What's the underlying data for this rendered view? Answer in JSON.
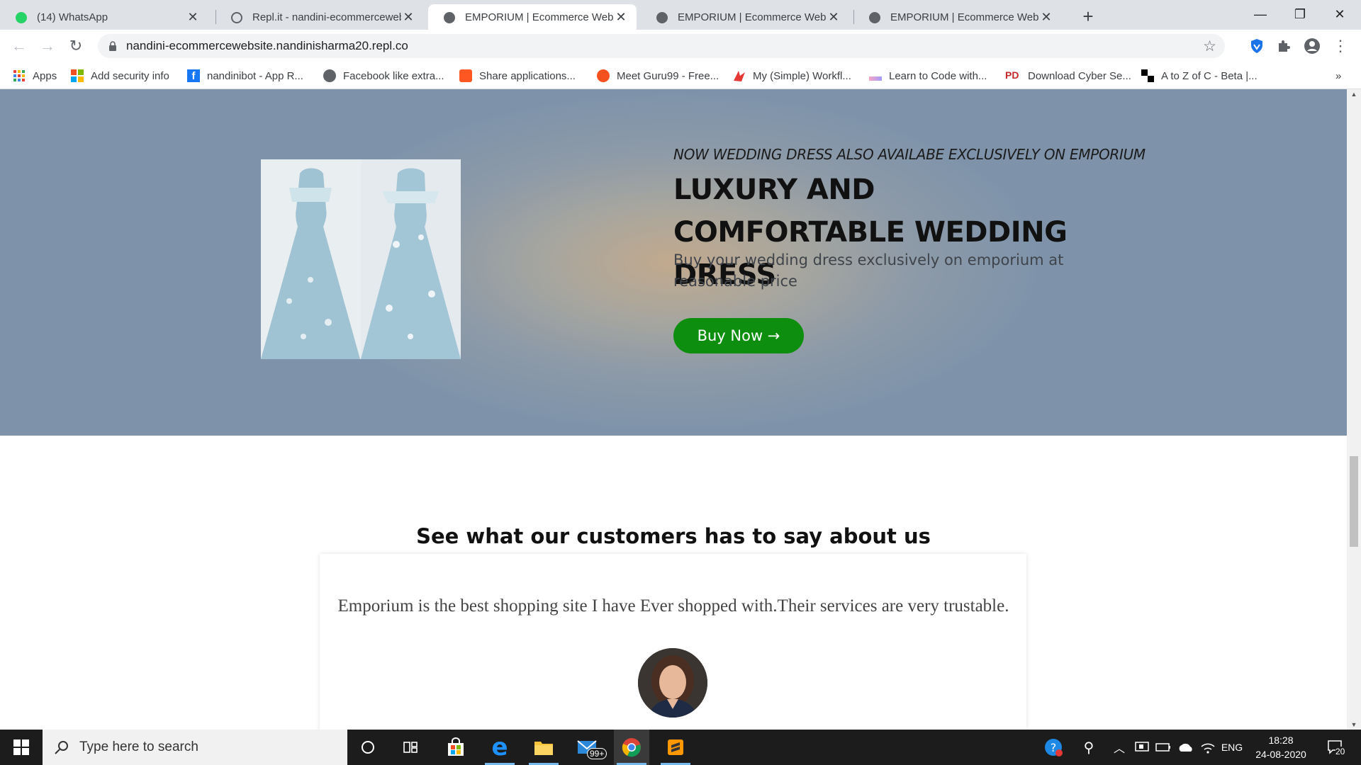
{
  "browser": {
    "tabs": [
      {
        "title": "(14) WhatsApp",
        "icon": "whatsapp-icon"
      },
      {
        "title": "Repl.it - nandini-ecommercewebsite",
        "icon": "replit-icon"
      },
      {
        "title": "EMPORIUM | Ecommerce Website",
        "icon": "globe-icon",
        "active": true
      },
      {
        "title": "EMPORIUM | Ecommerce Website",
        "icon": "globe-icon"
      },
      {
        "title": "EMPORIUM | Ecommerce Website",
        "icon": "globe-icon"
      }
    ],
    "url": "nandini-ecommercewebsite.nandinisharma20.repl.co",
    "bookmarks": [
      {
        "label": "Apps",
        "icon": "apps-grid-icon"
      },
      {
        "label": "Add security info",
        "icon": "microsoft-icon"
      },
      {
        "label": "nandinibot - App R...",
        "icon": "facebook-icon"
      },
      {
        "label": "Facebook like extra...",
        "icon": "globe-icon"
      },
      {
        "label": "Share applications...",
        "icon": "blogger-icon"
      },
      {
        "label": "Meet Guru99 - Free...",
        "icon": "guru99-icon"
      },
      {
        "label": "My (Simple) Workfl...",
        "icon": "workflow-icon"
      },
      {
        "label": "Learn to Code with...",
        "icon": "code-icon"
      },
      {
        "label": "Download Cyber Se...",
        "icon": "pd-icon"
      },
      {
        "label": "A to Z of C - Beta |...",
        "icon": "checker-icon"
      }
    ],
    "more_bookmarks": "»"
  },
  "hero": {
    "tagline": "NOW WEDDING DRESS ALSO AVAILABE EXCLUSIVELY ON EMPORIUM",
    "headline": "LUXURY AND COMFORTABLE WEDDING DRESS",
    "subtext": "Buy your wedding dress exclusively on emporium at reasonable price",
    "button": "Buy Now →"
  },
  "reviews": {
    "title": "See what our customers has to say about us",
    "quote": "Emporium is the best shopping site I have Ever shopped with.Their services are very trustable."
  },
  "taskbar": {
    "search_placeholder": "Type here to search",
    "mail_badge": "99+",
    "language": "ENG",
    "time": "18:28",
    "date": "24-08-2020",
    "notification_count": "20"
  },
  "colors": {
    "accent_button": "#0e8e0e",
    "tabstrip": "#dee1e6",
    "taskbar": "#1c1c1c"
  }
}
